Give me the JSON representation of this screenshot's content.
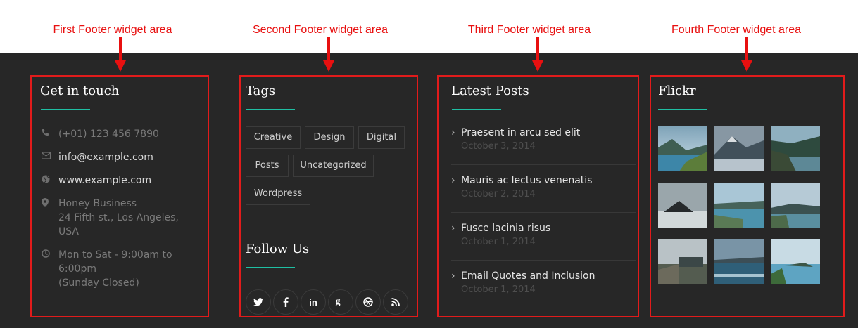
{
  "annotations": [
    "First Footer widget area",
    "Second Footer widget area",
    "Third Footer widget area",
    "Fourth Footer widget area"
  ],
  "contact": {
    "title": "Get in touch",
    "phone": "(+01) 123 456 7890",
    "email": "info@example.com",
    "website": "www.example.com",
    "address_line1": "Honey Business",
    "address_line2": "24 Fifth st., Los Angeles,",
    "address_line3": "USA",
    "hours_line1": "Mon to Sat - 9:00am to 6:00pm",
    "hours_line2": "(Sunday Closed)"
  },
  "tags": {
    "title": "Tags",
    "items": [
      "Creative",
      "Design",
      "Digital",
      "Posts",
      "Uncategorized",
      "Wordpress"
    ]
  },
  "follow": {
    "title": "Follow Us",
    "icons": [
      "twitter-icon",
      "facebook-icon",
      "linkedin-icon",
      "google-plus-icon",
      "dribbble-icon",
      "rss-icon"
    ]
  },
  "posts": {
    "title": "Latest Posts",
    "items": [
      {
        "title": "Praesent in arcu sed elit",
        "date": "October 3, 2014"
      },
      {
        "title": "Mauris ac lectus venenatis",
        "date": "October 2, 2014"
      },
      {
        "title": "Fusce lacinia risus",
        "date": "October 1, 2014"
      },
      {
        "title": "Email Quotes and Inclusion",
        "date": "October 1, 2014"
      }
    ]
  },
  "flickr": {
    "title": "Flickr"
  },
  "colors": {
    "annotation": "#e81010",
    "footer_bg": "#272727",
    "accent": "#1fbfa3"
  }
}
